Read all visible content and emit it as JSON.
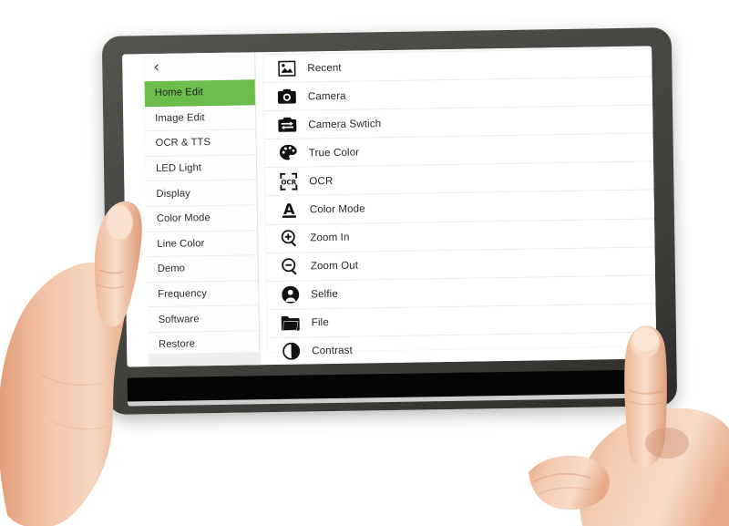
{
  "device": {
    "type": "tablet",
    "bezel_color": "#4a4945",
    "bottom_strip_color": "#050505"
  },
  "app": {
    "accent_color": "#6cbd4b",
    "background_color": "#ffffff",
    "text_color": "#262626"
  },
  "nav": {
    "back_icon": "‹"
  },
  "sidebar": {
    "selected": "Home Edit",
    "items": [
      {
        "label": "Home Edit",
        "active": true
      },
      {
        "label": "Image Edit",
        "active": false
      },
      {
        "label": "OCR & TTS",
        "active": false
      },
      {
        "label": "LED Light",
        "active": false
      },
      {
        "label": "Display",
        "active": false
      },
      {
        "label": "Color Mode",
        "active": false
      },
      {
        "label": "Line Color",
        "active": false
      },
      {
        "label": "Demo",
        "active": false
      },
      {
        "label": "Frequency",
        "active": false
      },
      {
        "label": "Software",
        "active": false
      },
      {
        "label": "Restore",
        "active": false
      }
    ]
  },
  "menu": {
    "items": [
      {
        "label": "Recent",
        "icon": "photo-icon"
      },
      {
        "label": "Camera",
        "icon": "camera-icon"
      },
      {
        "label": "Camera Swtich",
        "icon": "camera-switch-icon"
      },
      {
        "label": "True Color",
        "icon": "palette-icon"
      },
      {
        "label": "OCR",
        "icon": "ocr-scan-icon"
      },
      {
        "label": "Color Mode",
        "icon": "letter-a-underline-icon"
      },
      {
        "label": "Zoom In",
        "icon": "magnifier-plus-icon"
      },
      {
        "label": "Zoom Out",
        "icon": "magnifier-minus-icon"
      },
      {
        "label": "Selfie",
        "icon": "person-circle-icon"
      },
      {
        "label": "File",
        "icon": "folder-icon"
      },
      {
        "label": "Contrast",
        "icon": "contrast-half-circle-icon"
      }
    ]
  },
  "hands": {
    "left": "left-hand-gripping-tablet-edge",
    "right": "right-hand-index-finger-pointing"
  }
}
